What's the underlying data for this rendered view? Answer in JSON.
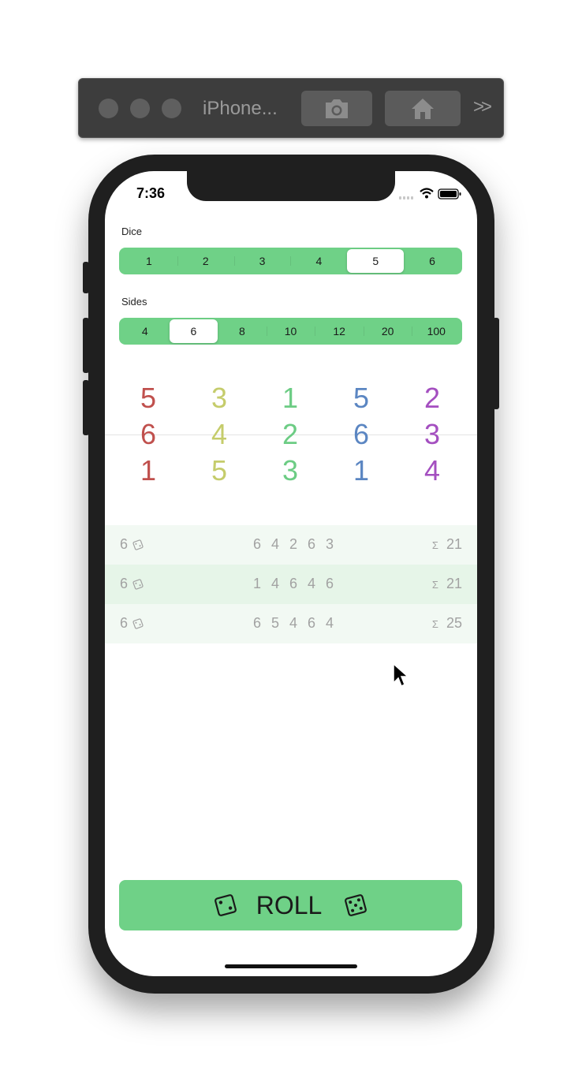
{
  "simulator": {
    "title": "iPhone...",
    "screenshot_icon": "camera-icon",
    "home_icon": "home-icon",
    "more_label": ">>"
  },
  "status_bar": {
    "time": "7:36"
  },
  "dice_selector": {
    "label": "Dice",
    "options": [
      "1",
      "2",
      "3",
      "4",
      "5",
      "6"
    ],
    "selected": "5"
  },
  "sides_selector": {
    "label": "Sides",
    "options": [
      "4",
      "6",
      "8",
      "10",
      "12",
      "20",
      "100"
    ],
    "selected": "6"
  },
  "pickers": [
    {
      "values": [
        "5",
        "6",
        "1"
      ],
      "color": "#c0504d"
    },
    {
      "values": [
        "3",
        "4",
        "5"
      ],
      "color": "#c5cc6b"
    },
    {
      "values": [
        "1",
        "2",
        "3"
      ],
      "color": "#6ccc84"
    },
    {
      "values": [
        "5",
        "6",
        "1"
      ],
      "color": "#5b86c2"
    },
    {
      "values": [
        "2",
        "3",
        "4"
      ],
      "color": "#a44fc0"
    }
  ],
  "history": [
    {
      "sides": "6",
      "values": "6 4 2 6 3",
      "sum": "21"
    },
    {
      "sides": "6",
      "values": "1 4 6 4 6",
      "sum": "21"
    },
    {
      "sides": "6",
      "values": "6 5 4 6 4",
      "sum": "25"
    }
  ],
  "sum_symbol": "Σ",
  "roll_button": {
    "label": "ROLL"
  },
  "colors": {
    "accent": "#6fd187",
    "history_row": "#f2f9f3",
    "history_row_alt": "#e6f5e8"
  }
}
